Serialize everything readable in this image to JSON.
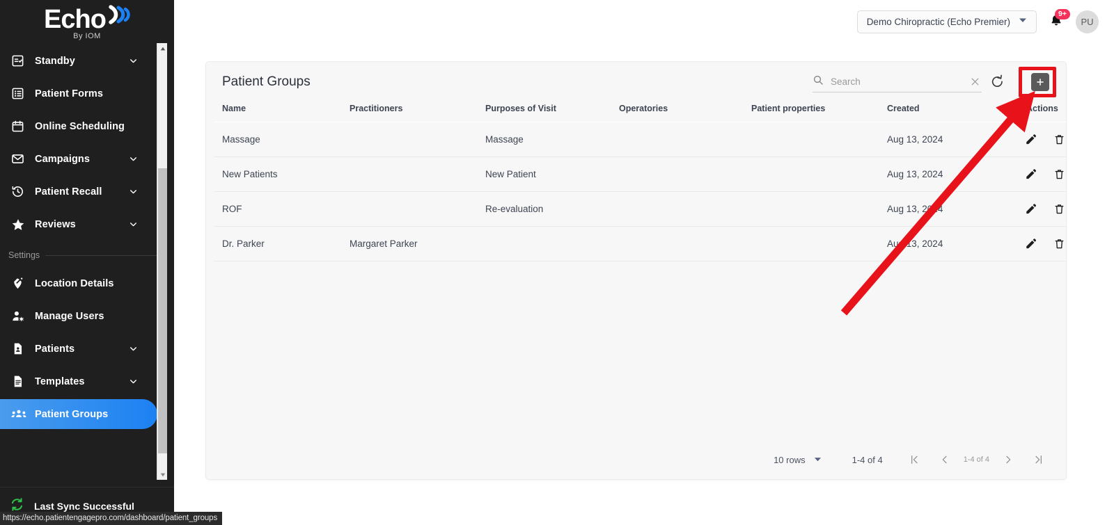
{
  "brand": {
    "logo_text": "Echo",
    "logo_sub": "By IOM",
    "accent_blue": "#1c81f2",
    "active_gradient_from": "#4a9ced",
    "active_gradient_to": "#1c81f2"
  },
  "sidebar": {
    "items": [
      {
        "label": "Standby",
        "icon": "checklist-icon",
        "chevron": true,
        "active": false
      },
      {
        "label": "Patient Forms",
        "icon": "form-list-icon",
        "chevron": false,
        "active": false
      },
      {
        "label": "Online Scheduling",
        "icon": "calendar-icon",
        "chevron": false,
        "active": false
      },
      {
        "label": "Campaigns",
        "icon": "envelope-icon",
        "chevron": true,
        "active": false
      },
      {
        "label": "Patient Recall",
        "icon": "history-clock-icon",
        "chevron": true,
        "active": false
      },
      {
        "label": "Reviews",
        "icon": "star-icon",
        "chevron": true,
        "active": false
      }
    ],
    "section_label": "Settings",
    "settings_items": [
      {
        "label": "Location Details",
        "icon": "location-pin-edit-icon",
        "chevron": false,
        "active": false
      },
      {
        "label": "Manage Users",
        "icon": "user-gear-icon",
        "chevron": false,
        "active": false
      },
      {
        "label": "Patients",
        "icon": "patient-card-icon",
        "chevron": true,
        "active": false
      },
      {
        "label": "Templates",
        "icon": "document-lines-icon",
        "chevron": true,
        "active": false
      },
      {
        "label": "Patient Groups",
        "icon": "people-group-icon",
        "chevron": false,
        "active": true
      }
    ],
    "sync_status": "Last Sync Successful"
  },
  "header": {
    "location": "Demo Chiropractic (Echo Premier)",
    "notification_badge": "9+",
    "avatar_initials": "PU"
  },
  "card": {
    "title": "Patient Groups",
    "search_placeholder": "Search",
    "search_value": "",
    "add_tooltip": "Add"
  },
  "table": {
    "columns": [
      "Name",
      "Practitioners",
      "Purposes of Visit",
      "Operatories",
      "Patient properties",
      "Created",
      "Actions"
    ],
    "rows": [
      {
        "name": "Massage",
        "practitioners": "",
        "purposes": "Massage",
        "operatories": "",
        "properties": "",
        "created": "Aug 13, 2024"
      },
      {
        "name": "New Patients",
        "practitioners": "",
        "purposes": "New Patient",
        "operatories": "",
        "properties": "",
        "created": "Aug 13, 2024"
      },
      {
        "name": "ROF",
        "practitioners": "",
        "purposes": "Re-evaluation",
        "operatories": "",
        "properties": "",
        "created": "Aug 13, 2024"
      },
      {
        "name": "Dr. Parker",
        "practitioners": "Margaret Parker",
        "purposes": "",
        "operatories": "",
        "properties": "",
        "created": "Aug 13, 2024"
      }
    ]
  },
  "pagination": {
    "rows_per_page": "10 rows",
    "count_label": "1-4 of 4",
    "range_label": "1-4 of 4"
  },
  "status_bar": {
    "url": "https://echo.patientengagepro.com/dashboard/patient_groups"
  },
  "annotation": {
    "highlight_color": "#e8131a",
    "target": "add-button"
  }
}
